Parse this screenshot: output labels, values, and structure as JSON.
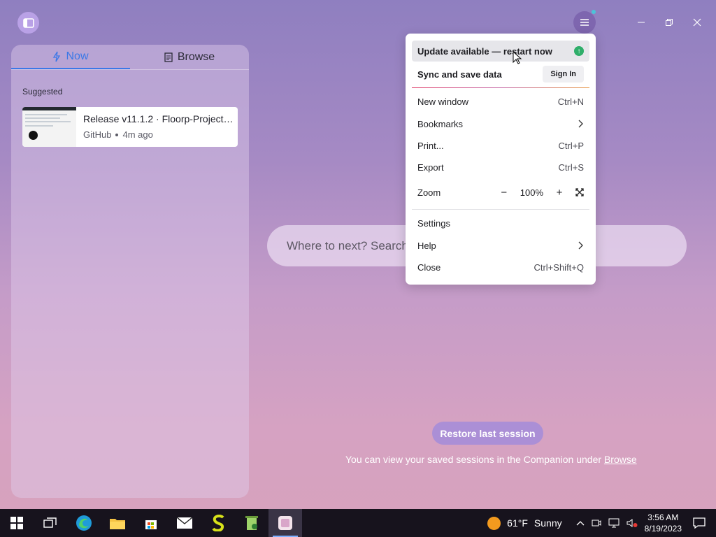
{
  "companion": {
    "tabs": [
      {
        "label": "Now",
        "icon": "lightning-icon",
        "active": true
      },
      {
        "label": "Browse",
        "icon": "document-icon",
        "active": false
      }
    ],
    "suggested_label": "Suggested",
    "card": {
      "title": "Release v11.1.2 · Floorp-Projects/...",
      "source": "GitHub",
      "time": "4m ago"
    }
  },
  "search": {
    "placeholder": "Where to next? Search"
  },
  "restore": {
    "button_label": "Restore last session",
    "hint_text": "You can view your saved sessions in the Companion under",
    "hint_link": "Browse"
  },
  "menu": {
    "update_label": "Update available — restart now",
    "sync_label": "Sync and save data",
    "signin_label": "Sign In",
    "items": [
      {
        "label": "New window",
        "shortcut": "Ctrl+N"
      },
      {
        "label": "Bookmarks",
        "shortcut": ""
      },
      {
        "label": "Print...",
        "shortcut": "Ctrl+P"
      },
      {
        "label": "Export",
        "shortcut": "Ctrl+S"
      }
    ],
    "zoom": {
      "label": "Zoom",
      "value": "100%",
      "minus": "−",
      "plus": "+"
    },
    "items2": [
      {
        "label": "Settings",
        "shortcut": ""
      },
      {
        "label": "Help",
        "shortcut": ""
      },
      {
        "label": "Close",
        "shortcut": "Ctrl+Shift+Q"
      }
    ]
  },
  "taskbar": {
    "apps": [
      "windows-start-icon",
      "task-view-icon",
      "edge-icon",
      "file-explorer-icon",
      "store-icon",
      "mail-icon",
      "s-app-icon",
      "recycle-app-icon",
      "arc-browser-icon"
    ],
    "weather": {
      "temp": "61°F",
      "condition": "Sunny"
    },
    "time": "3:56 AM",
    "date": "8/19/2023"
  },
  "colors": {
    "accent": "#3b78e7",
    "restore": "#ab8fd6",
    "update_green": "#2fae6a"
  }
}
